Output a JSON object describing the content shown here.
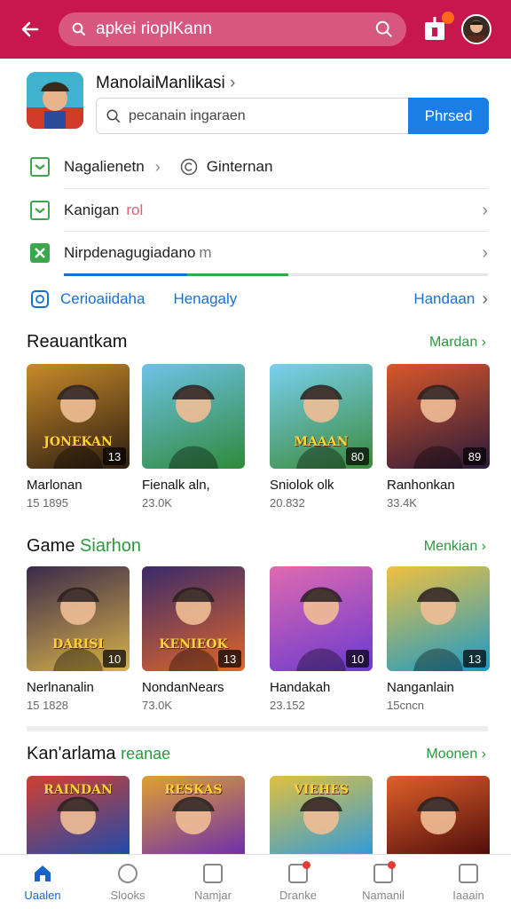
{
  "header": {
    "search_text": "apkei rioplKann",
    "colors": {
      "bar": "#c8174f"
    },
    "icons": [
      "back-arrow-icon",
      "search-icon",
      "notification-icon",
      "avatar"
    ]
  },
  "app": {
    "name": "ManolaiManlikasi",
    "search_placeholder": "pecanain ingaraen",
    "find_button": "Phrsed"
  },
  "options": [
    {
      "label": "Nagalienetn",
      "extra": "Ginternan"
    },
    {
      "label": "Kanigan",
      "extra": "rol"
    },
    {
      "label": "Nirpdenagugiadano",
      "extra": "m"
    }
  ],
  "links": {
    "left": "Cerioaiidaha",
    "middle": "Henagaly",
    "right": "Handaan"
  },
  "sections": [
    {
      "title": "Reauantkam",
      "title_accent": "",
      "more": "Mardan",
      "cards": [
        {
          "title": "Marlonan",
          "meta": "15 1895",
          "badge": "13",
          "art": "JONEKAN",
          "c1": "#2b1d12",
          "c2": "#c98a2a"
        },
        {
          "title": "Fienalk aln,",
          "meta": "23.0K",
          "badge": "",
          "art": "",
          "c1": "#2f8a3a",
          "c2": "#6fc2e8"
        },
        {
          "title": "Sniolok olk",
          "meta": "20.832",
          "badge": "80",
          "art": "MAAAN",
          "c1": "#3a8a3a",
          "c2": "#7ad0f0"
        },
        {
          "title": "Ranhonkan",
          "meta": "33.4K",
          "badge": "89",
          "art": "",
          "c1": "#2a1a3a",
          "c2": "#d9572a"
        }
      ]
    },
    {
      "title": "Game",
      "title_accent": "Siarhon",
      "more": "Menkian",
      "cards": [
        {
          "title": "Nerlnanalin",
          "meta": "15 1828",
          "badge": "10",
          "art": "DARISI",
          "c1": "#d8b24a",
          "c2": "#3a2a4a"
        },
        {
          "title": "NondanNears",
          "meta": "73.0K",
          "badge": "13",
          "art": "KENIEOK",
          "c1": "#e0662a",
          "c2": "#3a2a6a"
        },
        {
          "title": "Handakah",
          "meta": "23.152",
          "badge": "10",
          "art": "",
          "c1": "#6a3ad0",
          "c2": "#e06ab0"
        },
        {
          "title": "Nanganlain",
          "meta": "15cncn",
          "badge": "13",
          "art": "",
          "c1": "#1a9ac8",
          "c2": "#f0c040"
        }
      ]
    },
    {
      "title": "Kan'arlama",
      "title_accent": "reanae",
      "more": "Moonen",
      "cards": [
        {
          "title": "",
          "meta": "",
          "badge": "",
          "art": "RAINDAN",
          "c1": "#1a4ab0",
          "c2": "#d04030"
        },
        {
          "title": "",
          "meta": "",
          "badge": "",
          "art": "RESKAS",
          "c1": "#6a2ab0",
          "c2": "#e0a030"
        },
        {
          "title": "",
          "meta": "",
          "badge": "",
          "art": "VIEHES",
          "c1": "#2a9ae0",
          "c2": "#e0c040"
        },
        {
          "title": "",
          "meta": "",
          "badge": "",
          "art": "",
          "c1": "#4a0a0a",
          "c2": "#e0602a"
        }
      ]
    }
  ],
  "nav": [
    {
      "label": "Uaalen",
      "icon": "home-icon",
      "active": true
    },
    {
      "label": "Slooks",
      "icon": "compass-icon",
      "active": false
    },
    {
      "label": "Namjar",
      "icon": "apps-icon",
      "active": false
    },
    {
      "label": "Dranke",
      "icon": "updates-icon",
      "active": false
    },
    {
      "label": "Namanil",
      "icon": "gift-icon",
      "active": false
    },
    {
      "label": "Iaaain",
      "icon": "profile-icon",
      "active": false
    }
  ]
}
